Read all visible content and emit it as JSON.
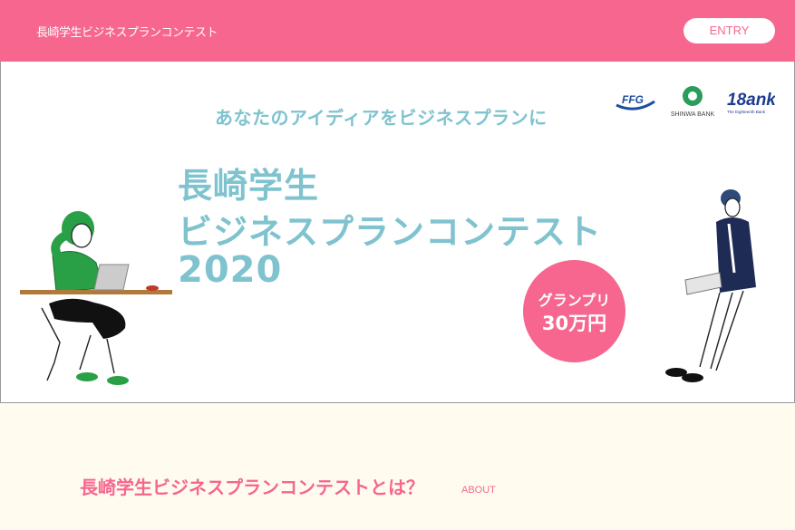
{
  "header": {
    "site_title": "長崎学生ビジネスプランコンテスト",
    "entry_label": "ENTRY"
  },
  "hero": {
    "catchphrase": "あなたのアイディアをビジネスプランに",
    "title_line1": "長崎学生",
    "title_line2": "ビジネスプランコンテスト",
    "title_line3": "2020",
    "prize_label": "グランプリ",
    "prize_amount": "30万円"
  },
  "sponsors": {
    "ffg": "FFG",
    "shinwa": "SHINWA BANK",
    "eighteen": "18ank",
    "eighteen_sub": "The Eighteenth Bank"
  },
  "about": {
    "heading": "長崎学生ビジネスプランコンテストとは？",
    "sub": "ABOUT"
  },
  "colors": {
    "brand_pink": "#f6668f",
    "title_blue": "#7fc3cf",
    "cream": "#fffcef"
  }
}
